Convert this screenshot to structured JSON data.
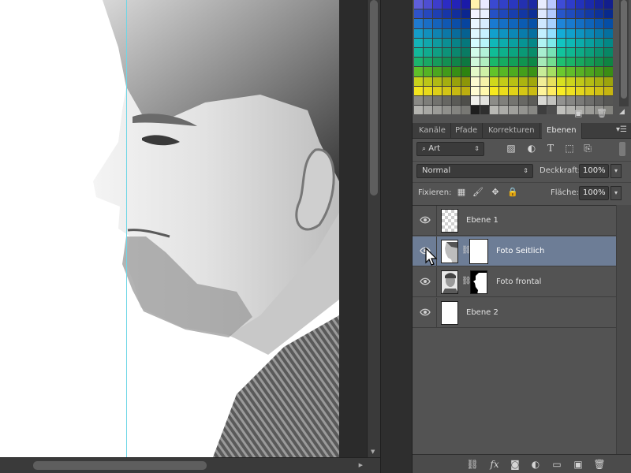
{
  "swatch_rows": [
    [
      "#5f5fd9",
      "#4e4ed2",
      "#3d3dcb",
      "#2c2cc4",
      "#2323b8",
      "#1a1aa8",
      "#fff2ad",
      "#e8e8ff",
      "#3a49d1",
      "#3240c8",
      "#2a37bf",
      "#2330b0",
      "#1c29a4",
      "#e8ecff",
      "#b9c8ff",
      "#3e4cd6",
      "#2e3cca",
      "#2232bb",
      "#1b2aab",
      "#16239a",
      "#121e8c"
    ],
    [
      "#2f53c9",
      "#2648bd",
      "#1e3fb2",
      "#1736a8",
      "#112e9d",
      "#0b2690",
      "#f5f5ff",
      "#e9f1ff",
      "#2551c5",
      "#1f48bb",
      "#183faf",
      "#1237a3",
      "#0d2f97",
      "#dfe9ff",
      "#b2cbff",
      "#2656c9",
      "#1f4cbd",
      "#1843b1",
      "#123aa5",
      "#0d3299",
      "#082a8d"
    ],
    [
      "#1f7ad0",
      "#1a6ec6",
      "#1563bc",
      "#1058b2",
      "#0b4ea8",
      "#07449e",
      "#eaf6ff",
      "#d6ecff",
      "#1a7ad0",
      "#1570c6",
      "#1066bc",
      "#0b5cb2",
      "#0752a8",
      "#cfe8ff",
      "#a8d2ff",
      "#1e85d8",
      "#197ace",
      "#146fc4",
      "#0f64ba",
      "#0a59b0",
      "#054ea6"
    ],
    [
      "#159cc8",
      "#1290bd",
      "#0f84b2",
      "#0c78a7",
      "#096c9c",
      "#066191",
      "#e0f8ff",
      "#c7f0ff",
      "#12a0cc",
      "#0f94c1",
      "#0c88b6",
      "#097cab",
      "#0670a0",
      "#c2f0ff",
      "#93e0ff",
      "#14acd6",
      "#11a0cb",
      "#0e94c0",
      "#0b88b5",
      "#087caa",
      "#05709f"
    ],
    [
      "#14b3b8",
      "#11a7ac",
      "#0e9ba0",
      "#0b8f94",
      "#088388",
      "#05777c",
      "#d6fbff",
      "#b8f5fa",
      "#10b8b8",
      "#0dacac",
      "#0aa0a0",
      "#079494",
      "#048888",
      "#b0f3f3",
      "#7ee9e9",
      "#12c4c0",
      "#0fb8b4",
      "#0cacaa",
      "#09a09e",
      "#069492",
      "#038886"
    ],
    [
      "#13b79a",
      "#11ab8f",
      "#0f9f84",
      "#0d9379",
      "#0b876e",
      "#097b63",
      "#d2fbea",
      "#b2f2d8",
      "#10bd96",
      "#0eb18b",
      "#0ca580",
      "#0a9975",
      "#088d6a",
      "#a8eed0",
      "#78e2b6",
      "#12c39c",
      "#10b791",
      "#0eab86",
      "#0c9f7b",
      "#0a9370",
      "#088765"
    ],
    [
      "#1cb46e",
      "#19a865",
      "#169c5c",
      "#139053",
      "#10844a",
      "#0d7841",
      "#d0f7da",
      "#b0efc0",
      "#19b86a",
      "#16ac61",
      "#13a058",
      "#10944f",
      "#0d8846",
      "#a6eab8",
      "#74de90",
      "#1ec070",
      "#1ab467",
      "#17a85e",
      "#149c55",
      "#11904c",
      "#0e8443"
    ],
    [
      "#5fbf2a",
      "#55b325",
      "#4ba720",
      "#419b1b",
      "#378f16",
      "#2d8311",
      "#e4f8c8",
      "#cff0a6",
      "#62c32a",
      "#58b725",
      "#4eab20",
      "#449f1b",
      "#3a9316",
      "#c8ec98",
      "#a6df62",
      "#6cc92e",
      "#62bd29",
      "#58b124",
      "#4ea51f",
      "#44991a",
      "#3a8d15"
    ],
    [
      "#c8d21c",
      "#bcc618",
      "#b0ba14",
      "#a4ae10",
      "#98a20c",
      "#8c9608",
      "#fcfad0",
      "#f6f2a8",
      "#d0d81c",
      "#c4cc18",
      "#b8c014",
      "#acb410",
      "#a0a80c",
      "#f2ee96",
      "#e8e05c",
      "#d8e020",
      "#ccd41c",
      "#c0c818",
      "#b4bc14",
      "#a8b010",
      "#9ca40c"
    ],
    [
      "#f3e51e",
      "#e8da1b",
      "#ddcf18",
      "#d2c415",
      "#c7b912",
      "#bcae0f",
      "#fffcd2",
      "#fff8ad",
      "#f6e81e",
      "#ebdd1b",
      "#e0d218",
      "#d5c715",
      "#cabc12",
      "#fff49a",
      "#ffec62",
      "#f8ec24",
      "#eee120",
      "#e4d61c",
      "#dacb18",
      "#d0c014",
      "#c6b510"
    ],
    [
      "#8a8a86",
      "#7e7e7a",
      "#72726e",
      "#666662",
      "#5a5a56",
      "#4e4e4a",
      "#f0f0ec",
      "#e2e2de",
      "#8c8c88",
      "#80807c",
      "#747470",
      "#686864",
      "#5c5c58",
      "#d8d8d4",
      "#c2c2be",
      "#929290",
      "#868684",
      "#7a7a78",
      "#6e6e6c",
      "#626260",
      "#565654"
    ],
    [
      "#b4b4b0",
      "#a8a8a4",
      "#9c9c98",
      "#90908c",
      "#848480",
      "#787874",
      "#1e1e1e",
      "#2e2e2e",
      "#b8b8b4",
      "#acaca8",
      "#a0a09c",
      "#949490",
      "#888884",
      "#3e3e3e",
      "#4e4e4e",
      "#c0c0bc",
      "#b4b4b0",
      "#a8a8a4",
      "#9c9c98",
      "#90908c",
      "#84847f"
    ]
  ],
  "tabs": [
    {
      "label": "Kanäle",
      "active": false
    },
    {
      "label": "Pfade",
      "active": false
    },
    {
      "label": "Korrekturen",
      "active": false
    },
    {
      "label": "Ebenen",
      "active": true
    }
  ],
  "filter": {
    "kind_label": "Art"
  },
  "blend": {
    "mode": "Normal",
    "opacity_label": "Deckkraft:",
    "opacity_value": "100%"
  },
  "lock": {
    "label": "Fixieren:",
    "fill_label": "Fläche:",
    "fill_value": "100%"
  },
  "layers": [
    {
      "name": "Ebene 1",
      "type": "transparent",
      "has_mask": false,
      "selected": false,
      "visible": true
    },
    {
      "name": "Foto Seitlich",
      "type": "photo-side",
      "has_mask": true,
      "mask": "white",
      "selected": true,
      "visible": true
    },
    {
      "name": "Foto frontal",
      "type": "photo-front",
      "has_mask": true,
      "mask": "silhouette",
      "selected": false,
      "visible": true
    },
    {
      "name": "Ebene 2",
      "type": "white",
      "has_mask": false,
      "selected": false,
      "visible": true
    }
  ],
  "colors": {
    "selected_layer": "#6d7d96",
    "guide": "#6fd6e6",
    "panel": "#535353"
  }
}
